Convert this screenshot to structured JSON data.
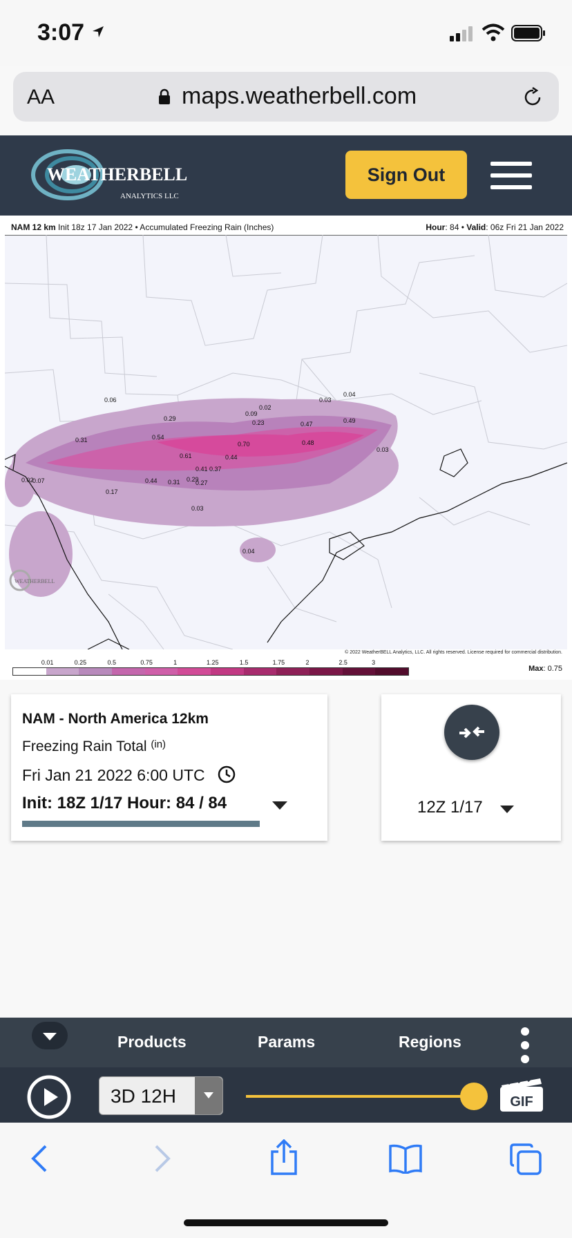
{
  "status_bar": {
    "time": "3:07"
  },
  "browser": {
    "aa_label": "AA",
    "url": "maps.weatherbell.com"
  },
  "header": {
    "logo_main": "WEATHERBELL",
    "logo_sub": "ANALYTICS LLC",
    "sign_out_label": "Sign Out"
  },
  "map": {
    "title_model": "NAM 12 km",
    "title_rest": " Init 18z 17 Jan 2022 • Accumulated Freezing Rain (Inches)",
    "hour_label": "Hour",
    "hour_value": ": 84 • ",
    "valid_label": "Valid",
    "valid_value": ": 06z Fri 21 Jan 2022",
    "copyright": "© 2022 WeatherBELL Analytics, LLC. All rights reserved. License required for commercial distribution.",
    "watermark": "WEATHERBELL",
    "max_label": "Max",
    "max_value": ": 0.75",
    "scale_ticks": [
      "0.01",
      "0.25",
      "0.5",
      "0.75",
      "1",
      "1.25",
      "1.5",
      "1.75",
      "2",
      "2.5",
      "3"
    ],
    "scale_colors": [
      "#ffffff",
      "#c8a6cc",
      "#b88abc",
      "#c467ad",
      "#cf5fa9",
      "#d24c98",
      "#c23a84",
      "#a82c6e",
      "#8f2158",
      "#7a1747",
      "#631038",
      "#520c2c"
    ],
    "point_values": [
      "0.06",
      "0.31",
      "0.29",
      "0.54",
      "0.61",
      "0.41",
      "0.37",
      "0.44",
      "0.70",
      "0.02",
      "0.09",
      "0.23",
      "0.47",
      "0.48",
      "0.49",
      "0.03",
      "0.04",
      "0.03",
      "0.02",
      "0.07",
      "0.17",
      "0.44",
      "0.31",
      "0.29",
      "0.27",
      "0.03",
      "0.04"
    ],
    "colors": {
      "light": "#c8a6cc",
      "medium": "#b882bb",
      "strong": "#cc62aa",
      "peak": "#d64a9c",
      "background": "#f3f4fb"
    }
  },
  "info_card": {
    "model": "NAM - North America 12km",
    "param": "Freezing Rain Total ",
    "param_unit": "(in)",
    "valid": "Fri Jan 21 2022 6:00 UTC",
    "init_hour": "Init: 18Z 1/17  Hour: 84 / 84"
  },
  "compare_card": {
    "run": "12Z 1/17"
  },
  "toolbar": {
    "products": "Products",
    "params": "Params",
    "regions": "Regions"
  },
  "player": {
    "range": "3D 12H",
    "gif_label": "GIF",
    "slider_position": 1.0
  },
  "theme": {
    "header_bg": "#2f3a4a",
    "accent": "#f4c23c",
    "ios_blue": "#2f7bf6"
  }
}
